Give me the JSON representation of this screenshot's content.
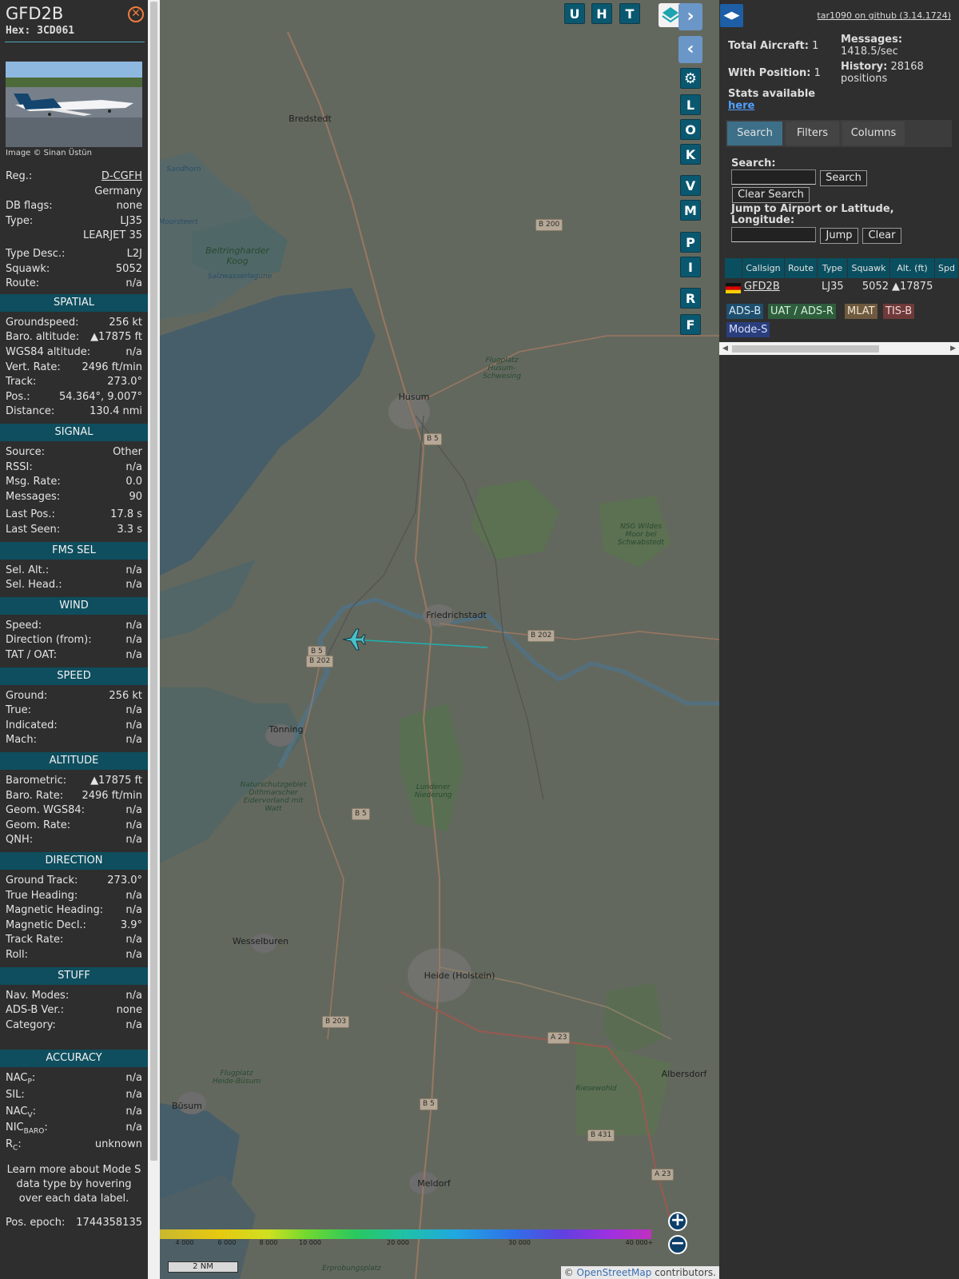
{
  "info": {
    "callsign": "GFD2B",
    "hex": "Hex: 3CD061",
    "photo_credit": "Image © Sinan Üstün",
    "close_icon": "close-icon",
    "rows_top": [
      {
        "k": "Reg.:",
        "v": "D-CGFH",
        "link": true
      },
      {
        "k": "",
        "v": "Germany"
      },
      {
        "k": "DB flags:",
        "v": "none"
      },
      {
        "k": "Type:",
        "v": "LJ35"
      },
      {
        "k": "",
        "v": "LEARJET 35"
      },
      {
        "k": "Type Desc.:",
        "v": "L2J"
      },
      {
        "k": "Squawk:",
        "v": "5052"
      },
      {
        "k": "Route:",
        "v": "n/a"
      }
    ],
    "spatial": {
      "title": "SPATIAL",
      "rows": [
        {
          "k": "Groundspeed:",
          "v": "256 kt"
        },
        {
          "k": "Baro. altitude:",
          "v": "▲17875 ft"
        },
        {
          "k": "WGS84 altitude:",
          "v": "n/a"
        },
        {
          "k": "Vert. Rate:",
          "v": "2496 ft/min"
        },
        {
          "k": "Track:",
          "v": "273.0°"
        },
        {
          "k": "Pos.:",
          "v": "54.364°, 9.007°"
        },
        {
          "k": "Distance:",
          "v": "130.4 nmi"
        }
      ]
    },
    "signal": {
      "title": "SIGNAL",
      "rows": [
        {
          "k": "Source:",
          "v": "Other"
        },
        {
          "k": "RSSI:",
          "v": "n/a"
        },
        {
          "k": "Msg. Rate:",
          "v": "0.0"
        },
        {
          "k": "Messages:",
          "v": "90"
        },
        {
          "k": "Last Pos.:",
          "v": "17.8 s"
        },
        {
          "k": "Last Seen:",
          "v": "3.3 s"
        }
      ]
    },
    "fms": {
      "title": "FMS SEL",
      "rows": [
        {
          "k": "Sel. Alt.:",
          "v": "n/a"
        },
        {
          "k": "Sel. Head.:",
          "v": "n/a"
        }
      ]
    },
    "wind": {
      "title": "WIND",
      "rows": [
        {
          "k": "Speed:",
          "v": "n/a"
        },
        {
          "k": "Direction (from):",
          "v": "n/a"
        },
        {
          "k": "TAT / OAT:",
          "v": "n/a"
        }
      ]
    },
    "speed": {
      "title": "SPEED",
      "rows": [
        {
          "k": "Ground:",
          "v": "256 kt"
        },
        {
          "k": "True:",
          "v": "n/a"
        },
        {
          "k": "Indicated:",
          "v": "n/a"
        },
        {
          "k": "Mach:",
          "v": "n/a"
        }
      ]
    },
    "altitude": {
      "title": "ALTITUDE",
      "rows": [
        {
          "k": "Barometric:",
          "v": "▲17875 ft"
        },
        {
          "k": "Baro. Rate:",
          "v": "2496 ft/min"
        },
        {
          "k": "Geom. WGS84:",
          "v": "n/a"
        },
        {
          "k": "Geom. Rate:",
          "v": "n/a"
        },
        {
          "k": "QNH:",
          "v": "n/a"
        }
      ]
    },
    "direction": {
      "title": "DIRECTION",
      "rows": [
        {
          "k": "Ground Track:",
          "v": "273.0°"
        },
        {
          "k": "True Heading:",
          "v": "n/a"
        },
        {
          "k": "Magnetic Heading:",
          "v": "n/a"
        },
        {
          "k": "Magnetic Decl.:",
          "v": "3.9°"
        },
        {
          "k": "Track Rate:",
          "v": "n/a"
        },
        {
          "k": "Roll:",
          "v": "n/a"
        }
      ]
    },
    "stuff": {
      "title": "STUFF",
      "rows": [
        {
          "k": "Nav. Modes:",
          "v": "n/a"
        },
        {
          "k": "ADS-B Ver.:",
          "v": "none"
        },
        {
          "k": "Category:",
          "v": "n/a"
        }
      ]
    },
    "accuracy": {
      "title": "ACCURACY",
      "rows": [
        {
          "k": "NAC",
          "sub": "P",
          "tail": ":",
          "v": "n/a"
        },
        {
          "k": "SIL:",
          "v": "n/a"
        },
        {
          "k": "NAC",
          "sub": "V",
          "tail": ":",
          "v": "n/a"
        },
        {
          "k": "NIC",
          "sub": "BARO",
          "tail": ":",
          "v": "n/a"
        },
        {
          "k": "R",
          "sub": "C",
          "tail": ":",
          "v": "unknown"
        }
      ]
    },
    "learn_more": "Learn more about Mode S data type by hovering over each data label.",
    "pos_epoch_label": "Pos. epoch:",
    "pos_epoch_value": "1744358135"
  },
  "map": {
    "buttons_top": [
      "U",
      "H",
      "T"
    ],
    "buttons_side": [
      "L",
      "O",
      "K",
      "V",
      "M",
      "P",
      "I",
      "R",
      "F"
    ],
    "places": [
      {
        "name": "Bredstedt",
        "cls": ""
      },
      {
        "name": "Husum",
        "cls": ""
      },
      {
        "name": "Friedrichstadt",
        "cls": ""
      },
      {
        "name": "Tönning",
        "cls": ""
      },
      {
        "name": "Wesselburen",
        "cls": ""
      },
      {
        "name": "Heide (Holstein)",
        "cls": ""
      },
      {
        "name": "Albersdorf",
        "cls": ""
      },
      {
        "name": "Büsum",
        "cls": ""
      },
      {
        "name": "Meldorf",
        "cls": ""
      },
      {
        "name": "Sandhorn",
        "cls": "water"
      },
      {
        "name": "Moorsteert",
        "cls": "water"
      },
      {
        "name": "Beltringharder Koog",
        "cls": "green"
      },
      {
        "name": "Salzwasserlagune",
        "cls": "water"
      },
      {
        "name": "Flugplatz Husum-Schwesing",
        "cls": "green"
      },
      {
        "name": "NSG Wildes Moor bei Schwabstedt",
        "cls": "green"
      },
      {
        "name": "Naturschutzgebiet Dithmarscher Eidervorland mit Watt",
        "cls": "green"
      },
      {
        "name": "Lundener Niederung",
        "cls": "green"
      },
      {
        "name": "Flugplatz Heide-Büsum",
        "cls": "green"
      },
      {
        "name": "Riesewohld",
        "cls": "green"
      },
      {
        "name": "Erprobungsplatz",
        "cls": "green"
      }
    ],
    "shields": [
      "B 200",
      "B 5",
      "B 5",
      "B 202",
      "B 202",
      "B 5",
      "B 203",
      "A 23",
      "B 5",
      "B 431",
      "A 23"
    ],
    "alt_ticks": [
      "4 000",
      "6 000",
      "8 000",
      "10 000",
      "20 000",
      "30 000",
      "40 000+"
    ],
    "scale_label": "2 NM",
    "attribution_prefix": "©",
    "attribution_link": "OpenStreetMap",
    "attribution_suffix": "contributors.",
    "zoom_in": "+",
    "zoom_out": "−"
  },
  "side": {
    "toggle": "◀▶",
    "github": "tar1090 on github (3.14.1724)",
    "total_aircraft_label": "Total Aircraft:",
    "total_aircraft": "1",
    "with_position_label": "With Position:",
    "with_position": "1",
    "stats_available": "Stats available",
    "here": "here",
    "messages_label": "Messages:",
    "messages_rate": "1418.5/sec",
    "history_label": "History:",
    "history_value": "28168",
    "history_unit": "positions",
    "tabs": [
      "Search",
      "Filters",
      "Columns"
    ],
    "search_label": "Search:",
    "search_button": "Search",
    "clear_search_button": "Clear Search",
    "jump_label": "Jump to Airport or Latitude, Longitude:",
    "jump_button": "Jump",
    "clear_button": "Clear",
    "search_value": "",
    "jump_value": "",
    "columns": [
      "Callsign",
      "Route",
      "Type",
      "Squawk",
      "Alt. (ft)",
      "Spd"
    ],
    "rows": [
      {
        "callsign": "GFD2B",
        "route": "",
        "type": "LJ35",
        "squawk": "5052",
        "alt": "▲17875",
        "spd": ""
      }
    ],
    "badges": [
      {
        "label": "ADS-B",
        "bg": "#1f4f6e",
        "fg": "#d8e8f4"
      },
      {
        "label": "UAT / ADS-R",
        "bg": "#2e5e3c",
        "fg": "#d6f0dc"
      },
      {
        "label": "MLAT",
        "bg": "#6e5a3e",
        "fg": "#f2e6d2"
      },
      {
        "label": "TIS-B",
        "bg": "#6e3a3a",
        "fg": "#f2d6d6"
      },
      {
        "label": "Mode-S",
        "bg": "#2a3e7e",
        "fg": "#d8e0f8"
      }
    ]
  }
}
